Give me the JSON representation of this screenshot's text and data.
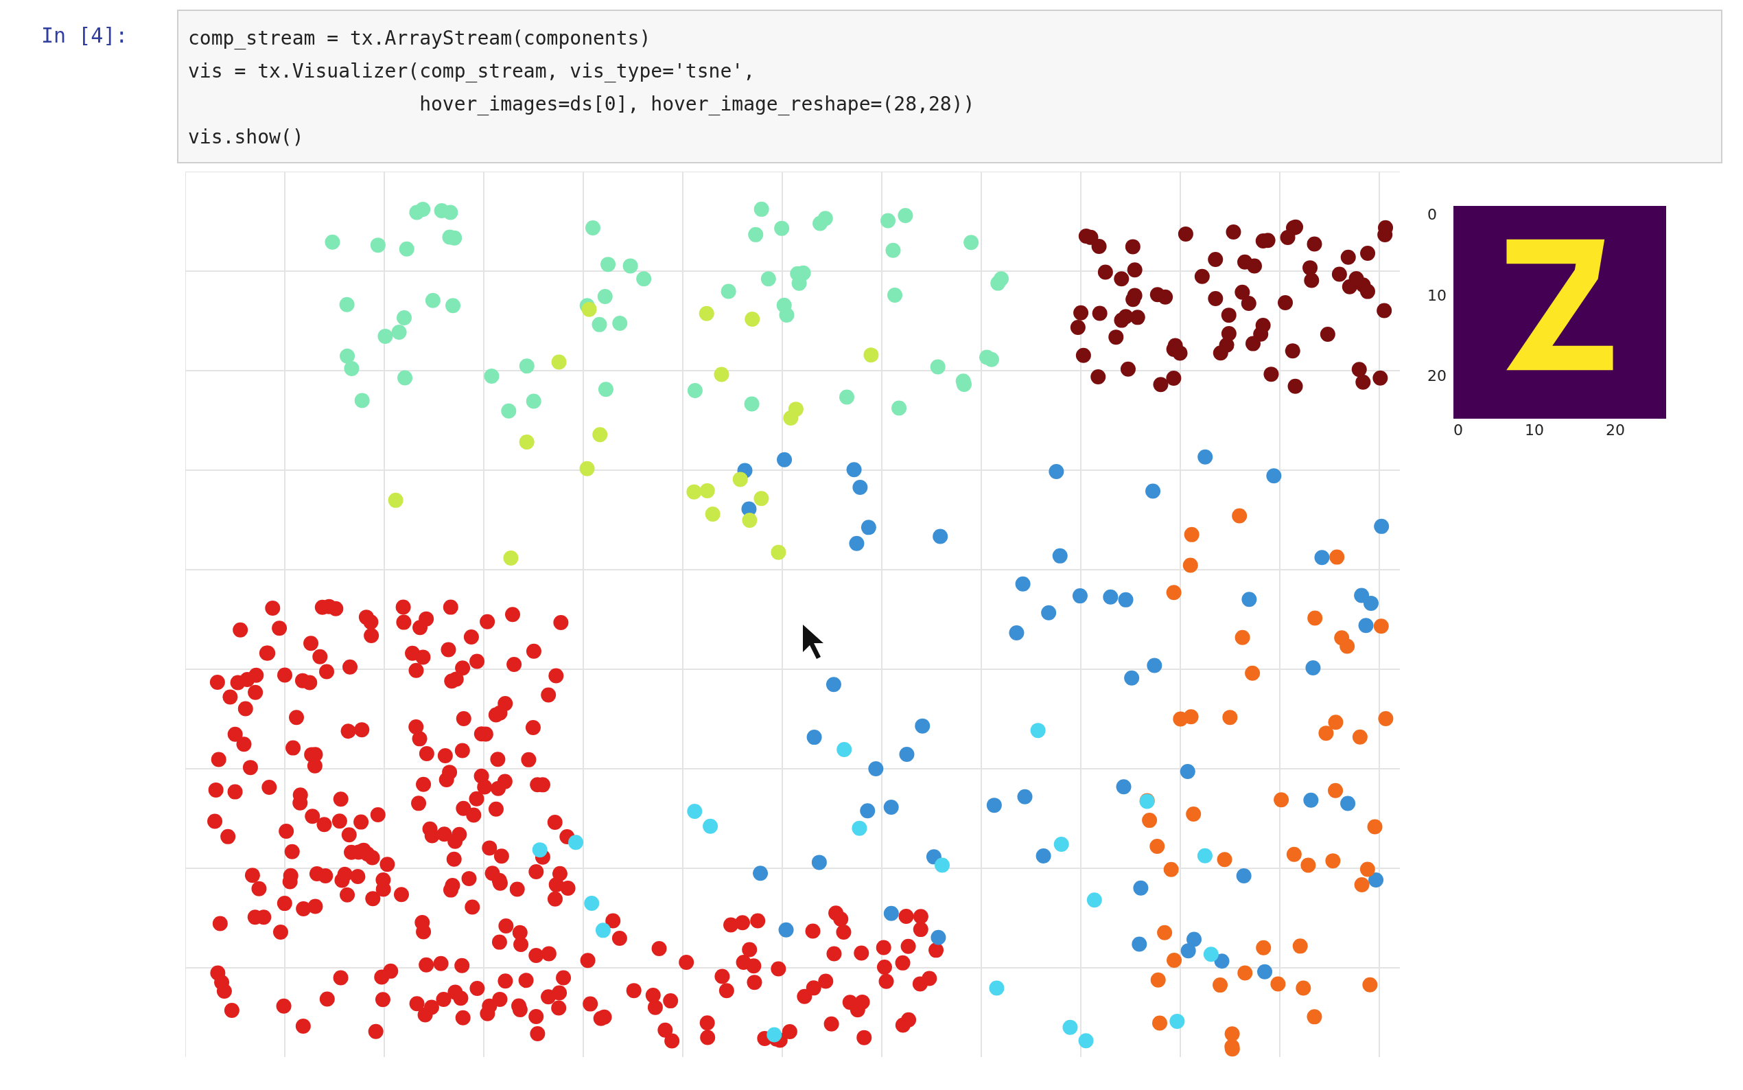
{
  "cell": {
    "prompt": "In [4]:",
    "code_lines": [
      "comp_stream = tx.ArrayStream(components)",
      "vis = tx.Visualizer(comp_stream, vis_type='tsne',",
      "                    hover_images=ds[0], hover_image_reshape=(28,28))",
      "vis.show()"
    ]
  },
  "output": {
    "hover_image": {
      "yticks": [
        "0",
        "10",
        "20"
      ],
      "xticks": [
        "0",
        "10",
        "20"
      ]
    }
  }
}
